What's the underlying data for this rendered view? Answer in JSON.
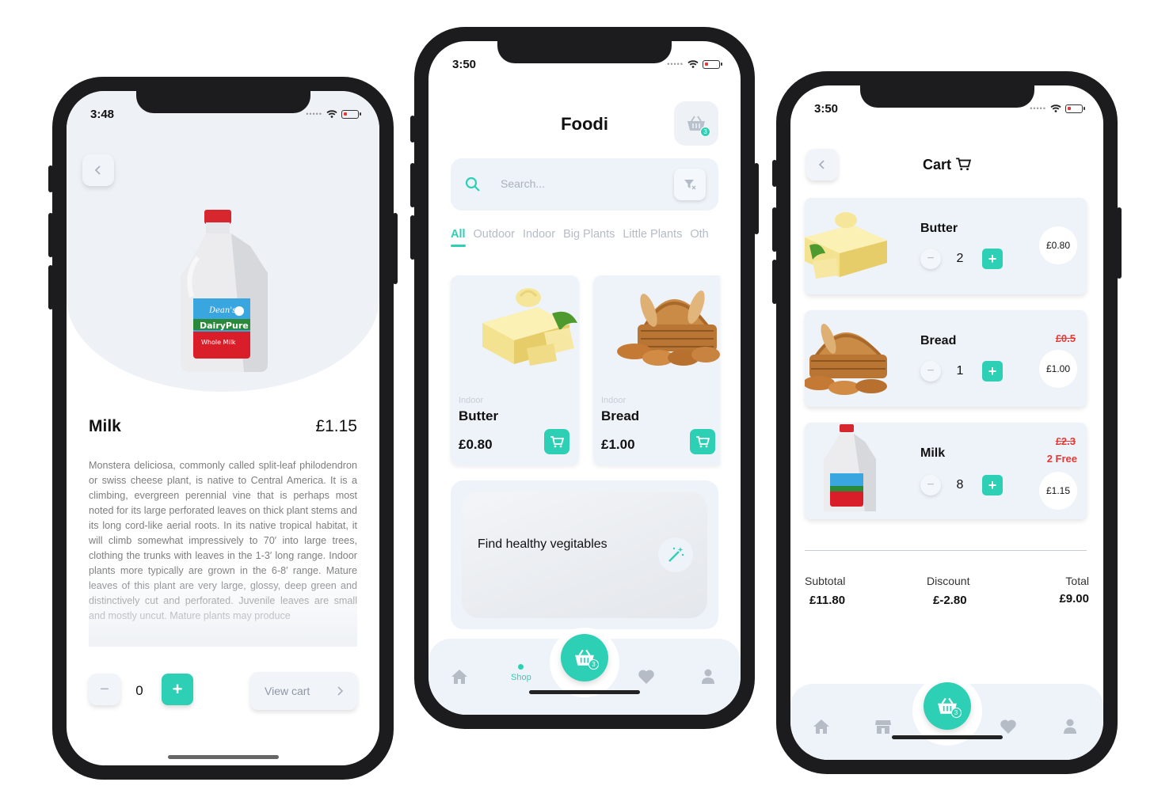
{
  "colors": {
    "accent": "#2ed0b5",
    "danger": "#e53935",
    "card": "#eef3f9"
  },
  "detail": {
    "time": "3:48",
    "title": "Milk",
    "price": "£1.15",
    "description": "Monstera deliciosa, commonly called split-leaf philodendron or swiss cheese plant, is native to Central America. It is a climbing, evergreen perennial vine that is perhaps most noted for its large perforated leaves on thick plant stems and its long cord-like aerial roots. In its native tropical habitat, it will climb somewhat impressively to 70′ into large trees, clothing the trunks with leaves in the 1-3′ long range. Indoor plants more typically are grown in the 6-8′ range. Mature leaves of this plant are very large, glossy, deep green and distinctively cut and perforated. Juvenile leaves are small and mostly uncut. Mature plants may produce",
    "quantity": "0",
    "minus_label": "−",
    "plus_label": "+",
    "view_cart_label": "View cart",
    "milk_brand": "Dean's",
    "milk_line": "DairyPure",
    "milk_type": "Whole Milk"
  },
  "shop": {
    "time": "3:50",
    "title": "Foodi",
    "cart_count": "3",
    "search_placeholder": "Search...",
    "tabs": [
      "All",
      "Outdoor",
      "Indoor",
      "Big Plants",
      "Little Plants",
      "Oth"
    ],
    "products": [
      {
        "category": "Indoor",
        "name": "Butter",
        "price": "£0.80"
      },
      {
        "category": "Indoor",
        "name": "Bread",
        "price": "£1.00"
      }
    ],
    "promo_text": "Find healthy vegitables",
    "nav": {
      "active_label": "Shop"
    }
  },
  "cart": {
    "time": "3:50",
    "title": "Cart",
    "cart_count": "3",
    "items": [
      {
        "name": "Butter",
        "qty": "2",
        "price": "£0.80",
        "old_price": "",
        "free": ""
      },
      {
        "name": "Bread",
        "qty": "1",
        "price": "£1.00",
        "old_price": "£0.5",
        "free": ""
      },
      {
        "name": "Milk",
        "qty": "8",
        "price": "£1.15",
        "old_price": "£2.3",
        "free": "2 Free"
      }
    ],
    "summary": {
      "subtotal_label": "Subtotal",
      "subtotal": "£11.80",
      "discount_label": "Discount",
      "discount": "£-2.80",
      "total_label": "Total",
      "total": "£9.00"
    },
    "minus_label": "−",
    "plus_label": "+"
  }
}
